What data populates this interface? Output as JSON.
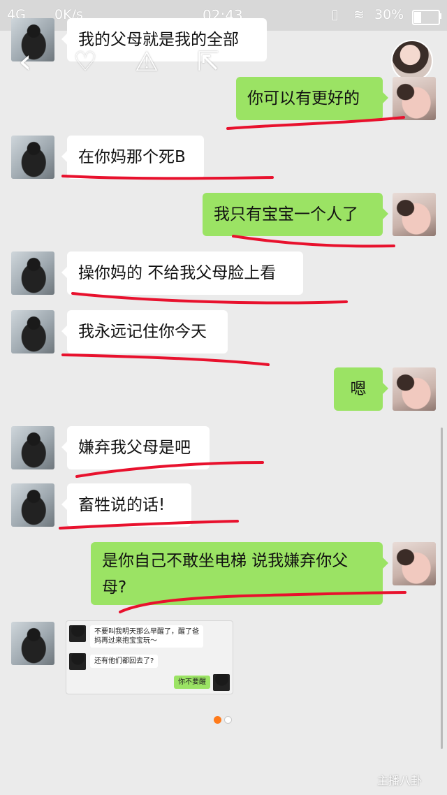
{
  "status_bar": {
    "network": "4G",
    "speed": "0K/s",
    "time": "02:43",
    "battery": "30%"
  },
  "messages": [
    {
      "side": "left",
      "text": "我的父母就是我的全部"
    },
    {
      "side": "right",
      "text": "你可以有更好的"
    },
    {
      "side": "left",
      "text": "在你妈那个死B"
    },
    {
      "side": "right",
      "text": "我只有宝宝一个人了"
    },
    {
      "side": "left",
      "text": "操你妈的 不给我父母脸上看"
    },
    {
      "side": "left",
      "text": "我永远记住你今天"
    },
    {
      "side": "right",
      "text": "嗯"
    },
    {
      "side": "left",
      "text": "嫌弃我父母是吧"
    },
    {
      "side": "left",
      "text": "畜牲说的话!"
    },
    {
      "side": "right",
      "text": "是你自己不敢坐电梯 说我嫌弃你父母?"
    }
  ],
  "embedded_screenshot": {
    "msg1": "不要叫我明天那么早醒了，醒了爸妈再过来抱宝宝玩～",
    "msg2": "还有他们都回去了?",
    "msg3": "你不要醒"
  },
  "watermark": {
    "main": "主播八卦"
  },
  "colors": {
    "sent_bubble": "#9be364",
    "received_bubble": "#ffffff",
    "underline": "#e8112d",
    "page_dot_active": "#ff7a1a"
  },
  "icons": [
    "back-icon",
    "heart-icon",
    "warning-icon",
    "share-icon"
  ]
}
